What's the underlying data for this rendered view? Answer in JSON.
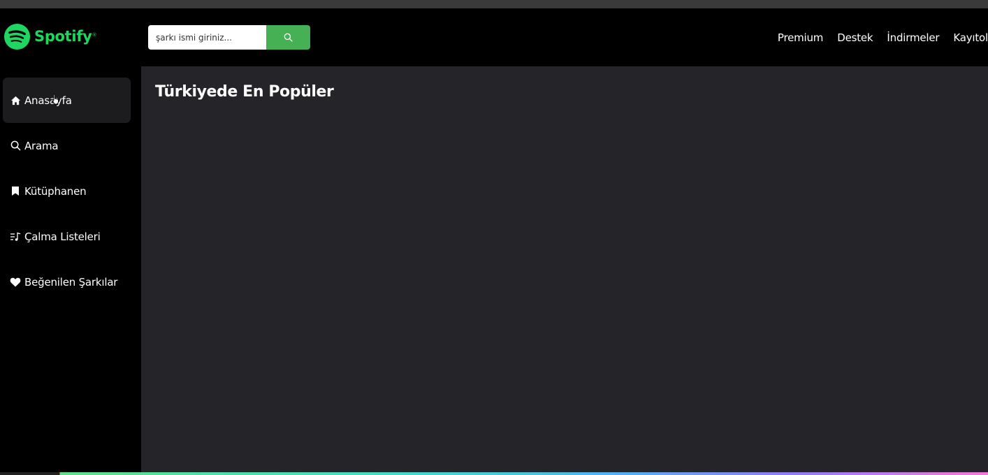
{
  "header": {
    "logo_text": "Spotify",
    "logo_mark": "®",
    "search_placeholder": "şarkı ismi giriniz...",
    "search_value": "",
    "search_icon": "search-icon",
    "nav": [
      "Premium",
      "Destek",
      "İndirmeler",
      "Kayıtol"
    ]
  },
  "sidebar": {
    "items": [
      {
        "label": "Anasayfa",
        "icon": "home-icon",
        "active": true
      },
      {
        "label": "Arama",
        "icon": "search-icon",
        "active": false
      },
      {
        "label": "Kütüphanen",
        "icon": "bookmark-icon",
        "active": false
      },
      {
        "label": "Çalma Listeleri",
        "icon": "playlist-icon",
        "active": false
      },
      {
        "label": "Beğenilen Şarkılar",
        "icon": "heart-icon",
        "active": false
      }
    ]
  },
  "main": {
    "title": "Türkiyede En Popüler"
  },
  "colors": {
    "brand": "#1ed760",
    "search_button": "#46b054",
    "sidebar_bg": "#000000",
    "main_bg": "#252428",
    "active_item_bg": "#1c1c1e"
  }
}
